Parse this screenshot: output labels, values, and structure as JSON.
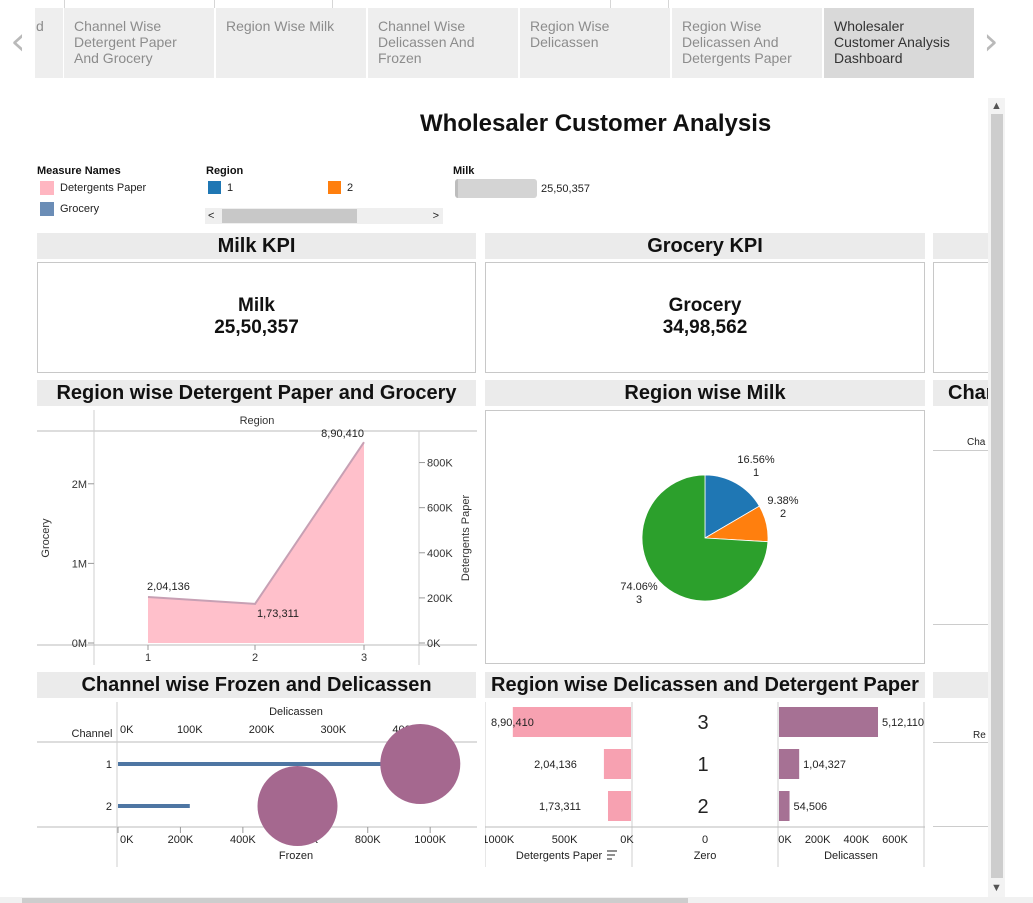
{
  "nav": {
    "prev_glyph": "‹",
    "next_glyph": "›"
  },
  "tabs": [
    {
      "label": "d",
      "active": false
    },
    {
      "label": "Channel Wise Detergent Paper And Grocery",
      "active": false
    },
    {
      "label": "Region Wise Milk",
      "active": false
    },
    {
      "label": "Channel Wise Delicassen And Frozen",
      "active": false
    },
    {
      "label": "Region Wise Delicassen",
      "active": false
    },
    {
      "label": "Region Wise Delicassen And Detergents Paper",
      "active": false
    },
    {
      "label": "Wholesaler Customer Analysis Dashboard",
      "active": true
    }
  ],
  "dashboard": {
    "title": "Wholesaler Customer Analysis",
    "legends": {
      "measure_names": {
        "title": "Measure Names",
        "items": [
          {
            "label": "Detergents Paper",
            "color": "#ffb6c1"
          },
          {
            "label": "Grocery",
            "color": "#6b8db6"
          }
        ]
      },
      "region": {
        "title": "Region",
        "items": [
          {
            "label": "1",
            "color": "#1f77b4"
          },
          {
            "label": "2",
            "color": "#ff7f0e"
          }
        ],
        "scroll_left": "<",
        "scroll_right": ">"
      },
      "milk": {
        "title": "Milk",
        "value": "25,50,357"
      }
    },
    "kpis": [
      {
        "header": "Milk KPI",
        "label": "Milk",
        "value": "25,50,357"
      },
      {
        "header": "Grocery KPI",
        "label": "Grocery",
        "value": "34,98,562"
      }
    ],
    "panel_headers": {
      "region_det_grocery": "Region wise Detergent Paper and Grocery",
      "region_milk": "Region wise Milk",
      "channel_cut": "Char",
      "channel_frozen_deli": "Channel wise Frozen and Delicassen",
      "region_deli_det": "Region wise Delicassen and Detergent Paper"
    },
    "cut_labels": {
      "channel_axis": "Cha",
      "region_axis": "Re"
    }
  },
  "chart_data": [
    {
      "type": "area",
      "title": "Region wise Detergent Paper and Grocery",
      "column_header": "Region",
      "categories": [
        "1",
        "2",
        "3"
      ],
      "xlabel": "",
      "y_left_label": "Grocery",
      "y_right_label": "Detergents Paper",
      "y_left_ticks": [
        "0M",
        "1M",
        "2M"
      ],
      "y_right_ticks": [
        "0K",
        "200K",
        "400K",
        "600K",
        "800K"
      ],
      "series": [
        {
          "name": "Detergents Paper",
          "color": "#ffc0cb",
          "values": [
            204136,
            173311,
            890410
          ],
          "labels": [
            "2,04,136",
            "1,73,311",
            "8,90,410"
          ]
        },
        {
          "name": "Grocery",
          "color": "#4e76a3",
          "values": [
            570000,
            430000,
            2500000
          ]
        }
      ],
      "ylim_left": [
        0,
        2550000
      ],
      "ylim_right": [
        0,
        900000
      ]
    },
    {
      "type": "pie",
      "title": "Region wise Milk",
      "slices": [
        {
          "label": "1",
          "percent": 16.56,
          "percent_label": "16.56%",
          "color": "#1f77b4"
        },
        {
          "label": "2",
          "percent": 9.38,
          "percent_label": "9.38%",
          "color": "#ff7f0e"
        },
        {
          "label": "3",
          "percent": 74.06,
          "percent_label": "74.06%",
          "color": "#2ca02c"
        }
      ]
    },
    {
      "type": "bar",
      "title": "Channel wise Frozen and Delicassen",
      "row_header": "Channel",
      "categories": [
        "1",
        "2"
      ],
      "top_axis_label": "Delicassen",
      "top_ticks": [
        "0K",
        "100K",
        "200K",
        "300K",
        "400K"
      ],
      "bottom_axis_label": "Frozen",
      "bottom_ticks": [
        "0K",
        "200K",
        "400K",
        "600K",
        "800K",
        "1000K"
      ],
      "series": [
        {
          "name": "Frozen",
          "color": "#4e76a3",
          "values": [
            880000,
            230000
          ]
        },
        {
          "name": "Delicassen",
          "color": "#a5688f",
          "values": [
            421000,
            250000
          ]
        }
      ],
      "xlim_frozen": [
        0,
        1150000
      ],
      "xlim_deli": [
        0,
        500000
      ]
    },
    {
      "type": "bar",
      "title": "Region wise Delicassen and Detergent Paper",
      "categories": [
        "3",
        "1",
        "2"
      ],
      "left_axis_label": "Detergents Paper",
      "left_ticks": [
        "1000K",
        "500K",
        "0K"
      ],
      "middle_axis_label": "Zero",
      "middle_ticks": [
        "0"
      ],
      "right_axis_label": "Delicassen",
      "right_ticks": [
        "0K",
        "200K",
        "400K",
        "600K"
      ],
      "series": [
        {
          "name": "Detergents Paper",
          "color": "#f7a1b1",
          "values": [
            890410,
            204136,
            173311
          ],
          "labels": [
            "8,90,410",
            "2,04,136",
            "1,73,311"
          ]
        },
        {
          "name": "Delicassen",
          "color": "#a67194",
          "values": [
            512110,
            104327,
            54506
          ],
          "labels": [
            "5,12,110",
            "1,04,327",
            "54,506"
          ]
        }
      ],
      "xlim_left": [
        0,
        1100000
      ],
      "xlim_right": [
        0,
        750000
      ]
    }
  ]
}
